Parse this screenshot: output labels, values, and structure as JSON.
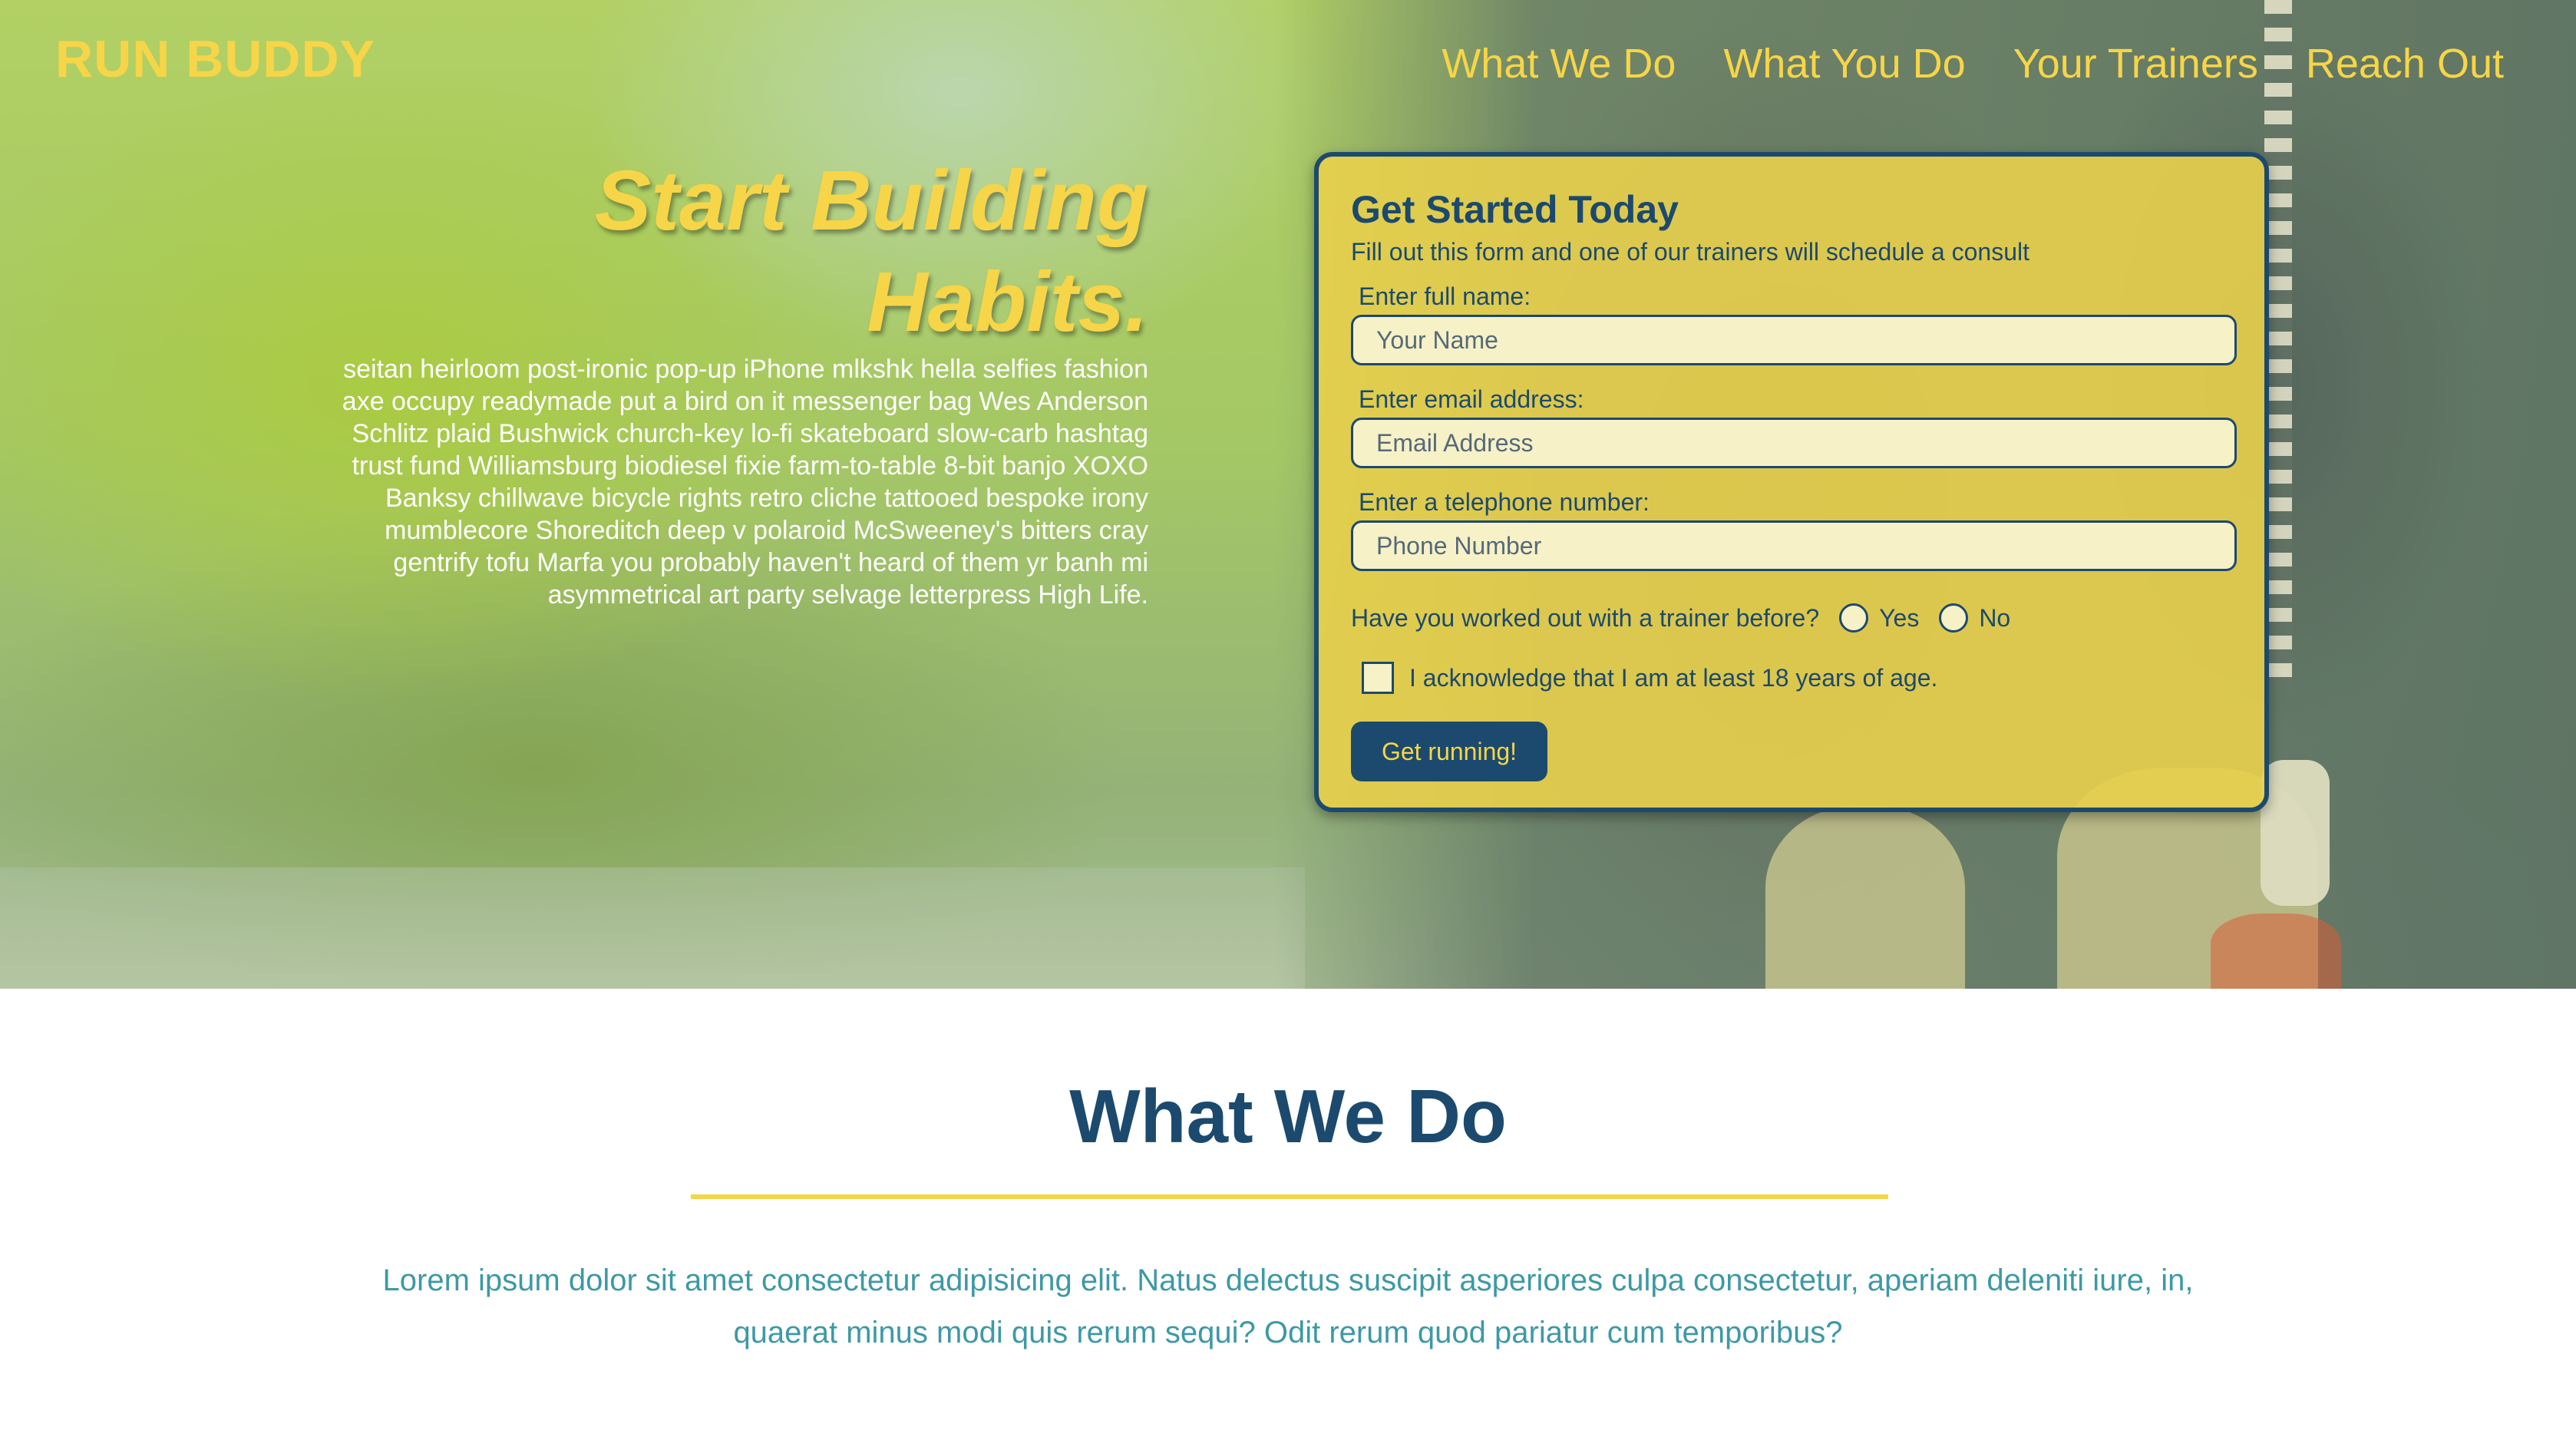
{
  "header": {
    "logo": "RUN BUDDY",
    "nav": [
      "What We Do",
      "What You Do",
      "Your Trainers",
      "Reach Out"
    ]
  },
  "hero": {
    "headline_line1": "Start Building",
    "headline_line2": "Habits.",
    "intro": "seitan heirloom post-ironic pop-up iPhone mlkshk hella selfies fashion axe occupy readymade put a bird on it messenger bag Wes Anderson Schlitz plaid Bushwick church-key lo-fi skateboard slow-carb hashtag trust fund Williamsburg biodiesel fixie farm-to-table 8-bit banjo XOXO Banksy chillwave bicycle rights retro cliche tattooed bespoke irony mumblecore Shoreditch deep v polaroid McSweeney's bitters cray gentrify tofu Marfa you probably haven't heard of them yr banh mi asymmetrical art party selvage letterpress High Life."
  },
  "form": {
    "title": "Get Started Today",
    "subtitle": "Fill out this form and one of our trainers will schedule a consult",
    "name": {
      "label": "Enter full name:",
      "placeholder": "Your Name",
      "value": ""
    },
    "email": {
      "label": "Enter email address:",
      "placeholder": "Email Address",
      "value": ""
    },
    "phone": {
      "label": "Enter a telephone number:",
      "placeholder": "Phone Number",
      "value": ""
    },
    "trainer_question": "Have you worked out with a trainer before?",
    "option_yes": "Yes",
    "option_no": "No",
    "acknowledge": "I acknowledge that I am at least 18 years of age.",
    "submit": "Get running!"
  },
  "what_we_do": {
    "title": "What We Do",
    "text": "Lorem ipsum dolor sit amet consectetur adipisicing elit. Natus delectus suscipit asperiores culpa consectetur, aperiam deleniti iure, in, quaerat minus modi quis rerum sequi? Odit rerum quod pariatur cum temporibus?"
  },
  "colors": {
    "brand_yellow": "#f7d548",
    "brand_navy": "#1c4a6e",
    "accent_teal": "#3d99a5"
  }
}
